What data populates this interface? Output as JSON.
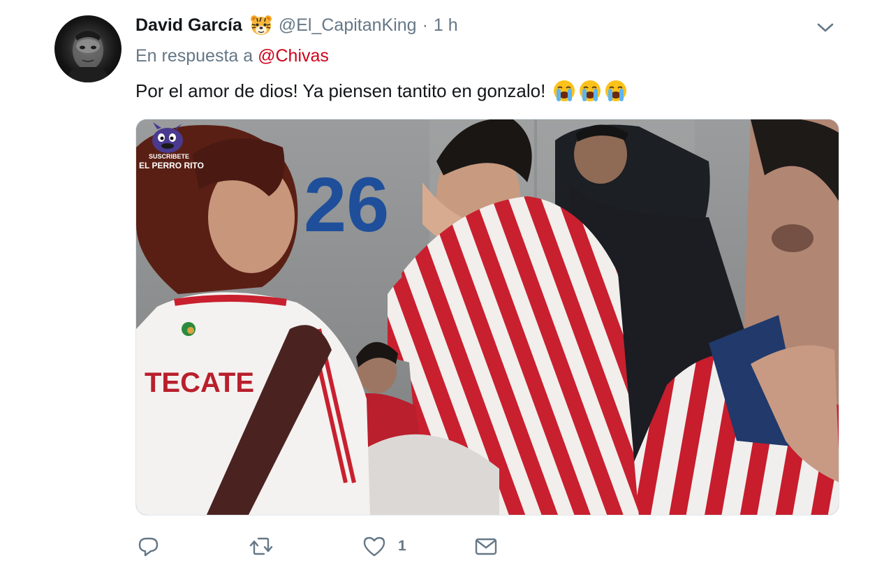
{
  "tweet": {
    "author": {
      "display_name": "David García",
      "handle": "@El_CapitanKing",
      "separator": "·",
      "timestamp": "1 h",
      "badge_icon": "tiger-face-icon"
    },
    "reply_context": {
      "prefix": "En respuesta a",
      "mention": "@Chivas"
    },
    "text": "Por el amor de dios! Ya piensen tantito en gonzalo!",
    "emojis": [
      "loudly-crying-face-icon",
      "loudly-crying-face-icon",
      "loudly-crying-face-icon"
    ],
    "media": {
      "watermark_line1": "SUSCRIBETE",
      "watermark_line2": "EL PERRO RITO",
      "wall_number": "26",
      "shirt_text": "TECATE"
    },
    "actions": {
      "reply_icon": "reply-icon",
      "retweet_icon": "retweet-icon",
      "like_icon": "heart-icon",
      "like_count": "1",
      "dm_icon": "envelope-icon"
    }
  },
  "colors": {
    "text_primary": "#14171a",
    "text_secondary": "#657786",
    "mention": "#d0021b",
    "border": "#e1e8ed"
  }
}
